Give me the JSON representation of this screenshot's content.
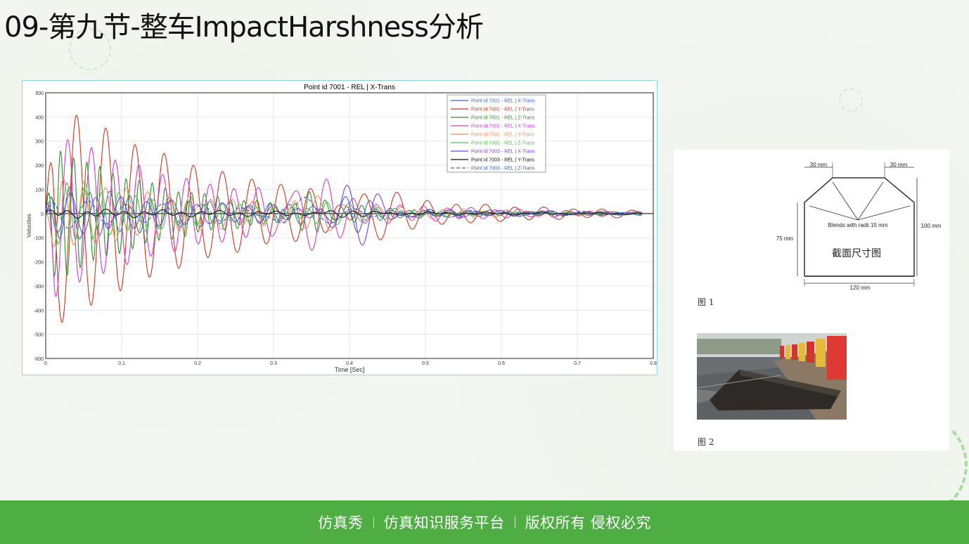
{
  "slide": {
    "title": "09-第九节-整车ImpactHarshness分析"
  },
  "chart_data": {
    "type": "line",
    "title": "Point id 7001 - REL | X-Trans",
    "xlabel": "Time [Sec]",
    "ylabel": "Velocities",
    "xlim": [
      0,
      0.8
    ],
    "ylim": [
      -600,
      500
    ],
    "x_ticks": [
      0,
      0.1,
      0.2,
      0.3,
      0.4,
      0.5,
      0.6,
      0.7,
      0.8
    ],
    "y_ticks": [
      500,
      400,
      300,
      200,
      100,
      0,
      -100,
      -200,
      -300,
      -400,
      -500,
      -600
    ],
    "grid": true,
    "legend_position": "top-right",
    "series": [
      {
        "name": "Point id 7001 - REL | X-Trans",
        "color": "#3a62c8",
        "dash": false,
        "amp": 120,
        "freq": 38,
        "decay": 4.0,
        "phase": 0.3,
        "burst_amp": 70,
        "burst_t": 0.39
      },
      {
        "name": "Point id 7001 - REL | Y-Trans",
        "color": "#c8381e",
        "dash": false,
        "amp": 500,
        "freq": 26,
        "decay": 4.6,
        "phase": 1.2,
        "burst_amp": 90,
        "burst_t": 0.42
      },
      {
        "name": "Point id 7001 - REL | Z-Trans",
        "color": "#2e8b2e",
        "dash": false,
        "amp": 300,
        "freq": 58,
        "decay": 6.5,
        "phase": 0.7,
        "burst_amp": 60,
        "burst_t": 0.36
      },
      {
        "name": "Point id 7002 - REL | X-Trans",
        "color": "#d13ad1",
        "dash": false,
        "amp": 360,
        "freq": 32,
        "decay": 5.0,
        "phase": 2.0,
        "burst_amp": 170,
        "burst_t": 0.34
      },
      {
        "name": "Point id 7002 - REL | Y-Trans",
        "color": "#f0905a",
        "dash": false,
        "amp": 160,
        "freq": 36,
        "decay": 4.2,
        "phase": 2.6,
        "burst_amp": 60,
        "burst_t": 0.38
      },
      {
        "name": "Point id 7002 - REL | Z-Trans",
        "color": "#4cbf4c",
        "dash": false,
        "amp": 140,
        "freq": 44,
        "decay": 5.5,
        "phase": 0.1,
        "burst_amp": 50,
        "burst_t": 0.4
      },
      {
        "name": "Point id 7003 - REL | X-Trans",
        "color": "#7a40d8",
        "dash": false,
        "amp": 90,
        "freq": 30,
        "decay": 3.6,
        "phase": 1.7,
        "burst_amp": 110,
        "burst_t": 0.41
      },
      {
        "name": "Point id 7003 - REL | Y-Trans",
        "color": "#111111",
        "dash": false,
        "amp": 14,
        "freq": 40,
        "decay": 2.5,
        "phase": 0.5,
        "burst_amp": 10,
        "burst_t": 0.4
      },
      {
        "name": "Point id 7003 - REL | Z-Trans",
        "color": "#2f5fb8",
        "dash": true,
        "amp": 60,
        "freq": 20,
        "decay": 3.0,
        "phase": 0.9,
        "burst_amp": 80,
        "burst_t": 0.33
      }
    ]
  },
  "diagram": {
    "dim_top_left": "30 mm",
    "dim_top_right": "30 mm",
    "dim_left": "75 mm",
    "dim_right": "100 mm",
    "dim_bottom": "120 mm",
    "blend_note": "Blends with radii 15 mm",
    "section_label": "截面尺寸图",
    "caption1": "图 1",
    "caption2": "图 2"
  },
  "footer": {
    "brand": "仿真秀",
    "slogan": "仿真知识服务平台",
    "rights": "版权所有 侵权必究"
  }
}
